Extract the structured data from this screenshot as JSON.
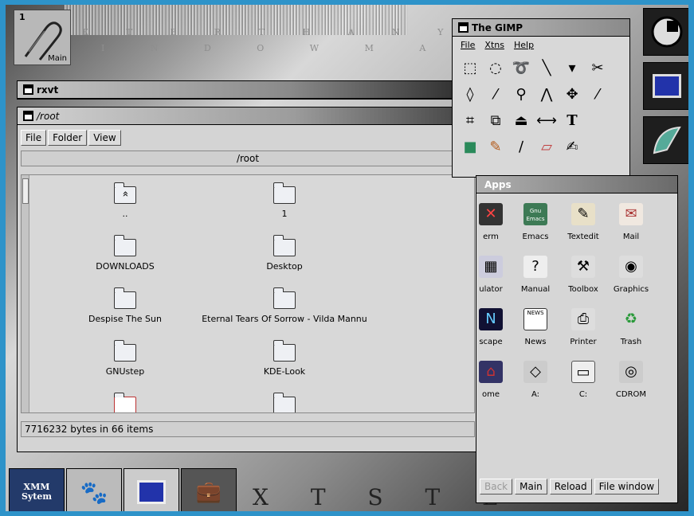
{
  "desktop": {
    "wm_text_top": "E T E R T H A N Y O U",
    "wm_text_mid": "I N D O W M A",
    "wm_text_bottom": "X T S T E",
    "main_tile": {
      "number": "1",
      "label": "Main"
    }
  },
  "rxvt": {
    "title": "rxvt"
  },
  "root_window": {
    "title": "/root",
    "menu": [
      "File",
      "Folder",
      "View"
    ],
    "path": "/root",
    "items": [
      {
        "name": "..",
        "icon": "parent-folder-icon"
      },
      {
        "name": "1",
        "icon": "folder-icon"
      },
      {
        "name": "DOWNLOADS",
        "icon": "folder-icon"
      },
      {
        "name": "Desktop",
        "icon": "folder-icon"
      },
      {
        "name": "Despise The Sun",
        "icon": "folder-icon"
      },
      {
        "name": "Eternal Tears Of Sorrow - Vilda Mannu",
        "icon": "folder-icon"
      },
      {
        "name": "GNUstep",
        "icon": "folder-icon"
      },
      {
        "name": "KDE-Look",
        "icon": "folder-icon"
      }
    ],
    "status": "7716232 bytes in 66 items"
  },
  "gimp": {
    "title": "The GIMP",
    "menu": [
      "File",
      "Xtns",
      "Help"
    ],
    "tools": [
      "rect-select-icon",
      "ellipse-select-icon",
      "lasso-icon",
      "magic-wand-icon",
      "color-picker-icon",
      "scissors-icon",
      "bezier-icon",
      "eyedropper-icon",
      "magnify-icon",
      "measure-icon",
      "move-icon",
      "brush-icon",
      "crop-icon",
      "transform-icon",
      "flip-icon",
      "resize-icon",
      "text-icon",
      "blank",
      "fg-bg-icon",
      "pencil-icon",
      "airbrush-icon",
      "eraser-icon",
      "smudge-icon",
      "blank"
    ],
    "text_tool_glyph": "T"
  },
  "apps": {
    "title": "Apps",
    "items": [
      {
        "label": "erm",
        "icon": "xterm-icon"
      },
      {
        "label": "Emacs",
        "icon": "emacs-icon"
      },
      {
        "label": "Textedit",
        "icon": "textedit-icon"
      },
      {
        "label": "Mail",
        "icon": "mail-icon"
      },
      {
        "label": "ulator",
        "icon": "calculator-icon"
      },
      {
        "label": "Manual",
        "icon": "manual-icon"
      },
      {
        "label": "Toolbox",
        "icon": "toolbox-icon"
      },
      {
        "label": "Graphics",
        "icon": "graphics-icon"
      },
      {
        "label": "scape",
        "icon": "netscape-icon"
      },
      {
        "label": "News",
        "icon": "news-icon"
      },
      {
        "label": "Printer",
        "icon": "printer-icon"
      },
      {
        "label": "Trash",
        "icon": "trash-icon"
      },
      {
        "label": "ome",
        "icon": "home-icon"
      },
      {
        "label": "A:",
        "icon": "floppy-icon"
      },
      {
        "label": "C:",
        "icon": "harddisk-icon"
      },
      {
        "label": "CDROM",
        "icon": "cdrom-icon"
      }
    ],
    "emacs_badge": "Gnu Emacs",
    "news_badge": "NEWS",
    "buttons": [
      "Back",
      "Main",
      "Reload",
      "File window"
    ]
  },
  "dock_bottom": {
    "xmms_label": "XMM Sytem"
  }
}
